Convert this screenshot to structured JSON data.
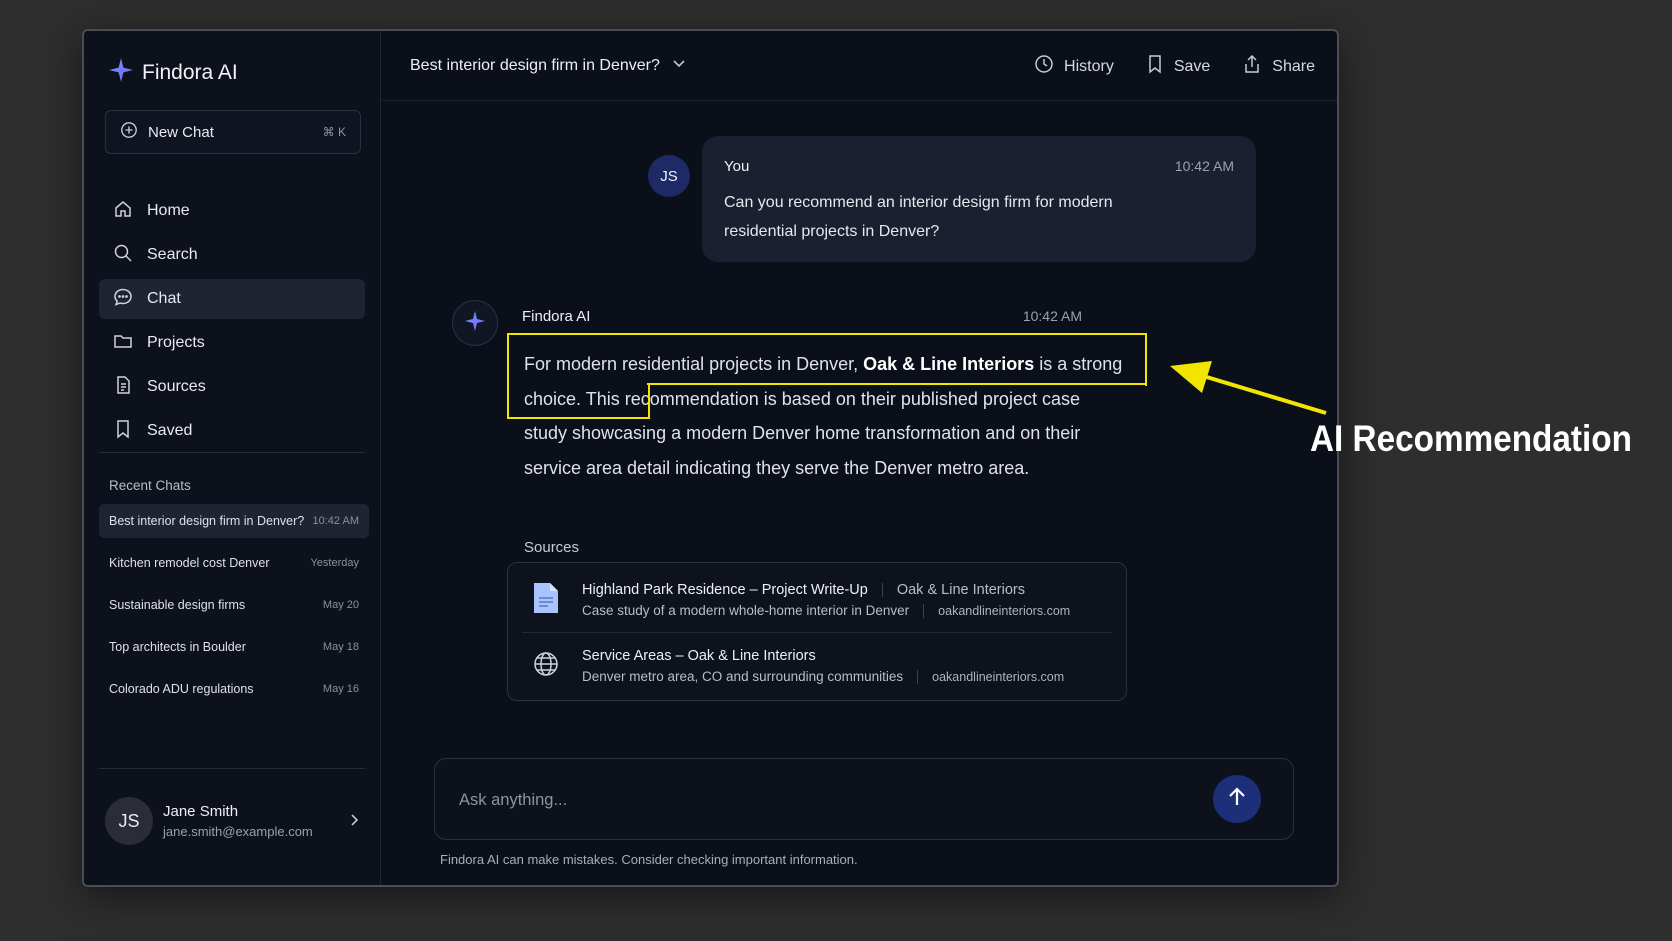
{
  "brand": {
    "name": "Findora AI"
  },
  "sidebar": {
    "new_chat_label": "New Chat",
    "new_chat_shortcut": "⌘ K",
    "nav": [
      {
        "label": "Home",
        "icon": "home-icon"
      },
      {
        "label": "Search",
        "icon": "search-icon"
      },
      {
        "label": "Chat",
        "icon": "chat-bubble-icon",
        "active": true
      },
      {
        "label": "Projects",
        "icon": "folder-icon"
      },
      {
        "label": "Sources",
        "icon": "document-icon"
      },
      {
        "label": "Saved",
        "icon": "bookmark-icon"
      }
    ],
    "recent_title": "Recent Chats",
    "recent": [
      {
        "title": "Best interior design firm in Denver?",
        "time": "10:42 AM",
        "active": true
      },
      {
        "title": "Kitchen remodel cost Denver",
        "time": "Yesterday"
      },
      {
        "title": "Sustainable design firms",
        "time": "May 20"
      },
      {
        "title": "Top architects in Boulder",
        "time": "May 18"
      },
      {
        "title": "Colorado ADU regulations",
        "time": "May 16"
      }
    ],
    "user": {
      "initials": "JS",
      "name": "Jane Smith",
      "email": "jane.smith@example.com"
    }
  },
  "header": {
    "chat_title": "Best interior design firm in Denver?",
    "actions": {
      "history": "History",
      "save": "Save",
      "share": "Share"
    }
  },
  "conversation": {
    "user_message": {
      "initials": "JS",
      "author": "You",
      "time": "10:42 AM",
      "text": "Can you recommend an interior design firm for modern residential projects in Denver?"
    },
    "ai_message": {
      "author": "Findora AI",
      "time": "10:42 AM",
      "text_part1": "For modern residential projects in Denver, ",
      "text_bold": "Oak & Line Interiors",
      "text_part2": " is a strong choice. This recommendation is based on their published project case study showcasing a modern Denver home transformation and on their service area detail indicating they serve the Denver metro area."
    },
    "sources_label": "Sources",
    "sources": [
      {
        "icon": "document-icon",
        "title": "Highland Park Residence – Project Write-Up",
        "publisher": "Oak & Line Interiors",
        "description": "Case study of a modern whole-home interior in Denver",
        "domain": "oakandlineinteriors.com"
      },
      {
        "icon": "globe-icon",
        "title": "Service Areas – Oak & Line Interiors",
        "description": "Denver metro area, CO and surrounding communities",
        "domain": "oakandlineinteriors.com"
      }
    ]
  },
  "composer": {
    "placeholder": "Ask anything...",
    "disclaimer": "Findora AI can make mistakes. Consider checking important information."
  },
  "annotation": {
    "label": "AI Recommendation",
    "color": "#f2e600"
  },
  "colors": {
    "background": "#2e2e2f",
    "app_bg": "#0b0f1a",
    "accent": "#1e2f7a",
    "brand_star": "#7b6cff"
  }
}
